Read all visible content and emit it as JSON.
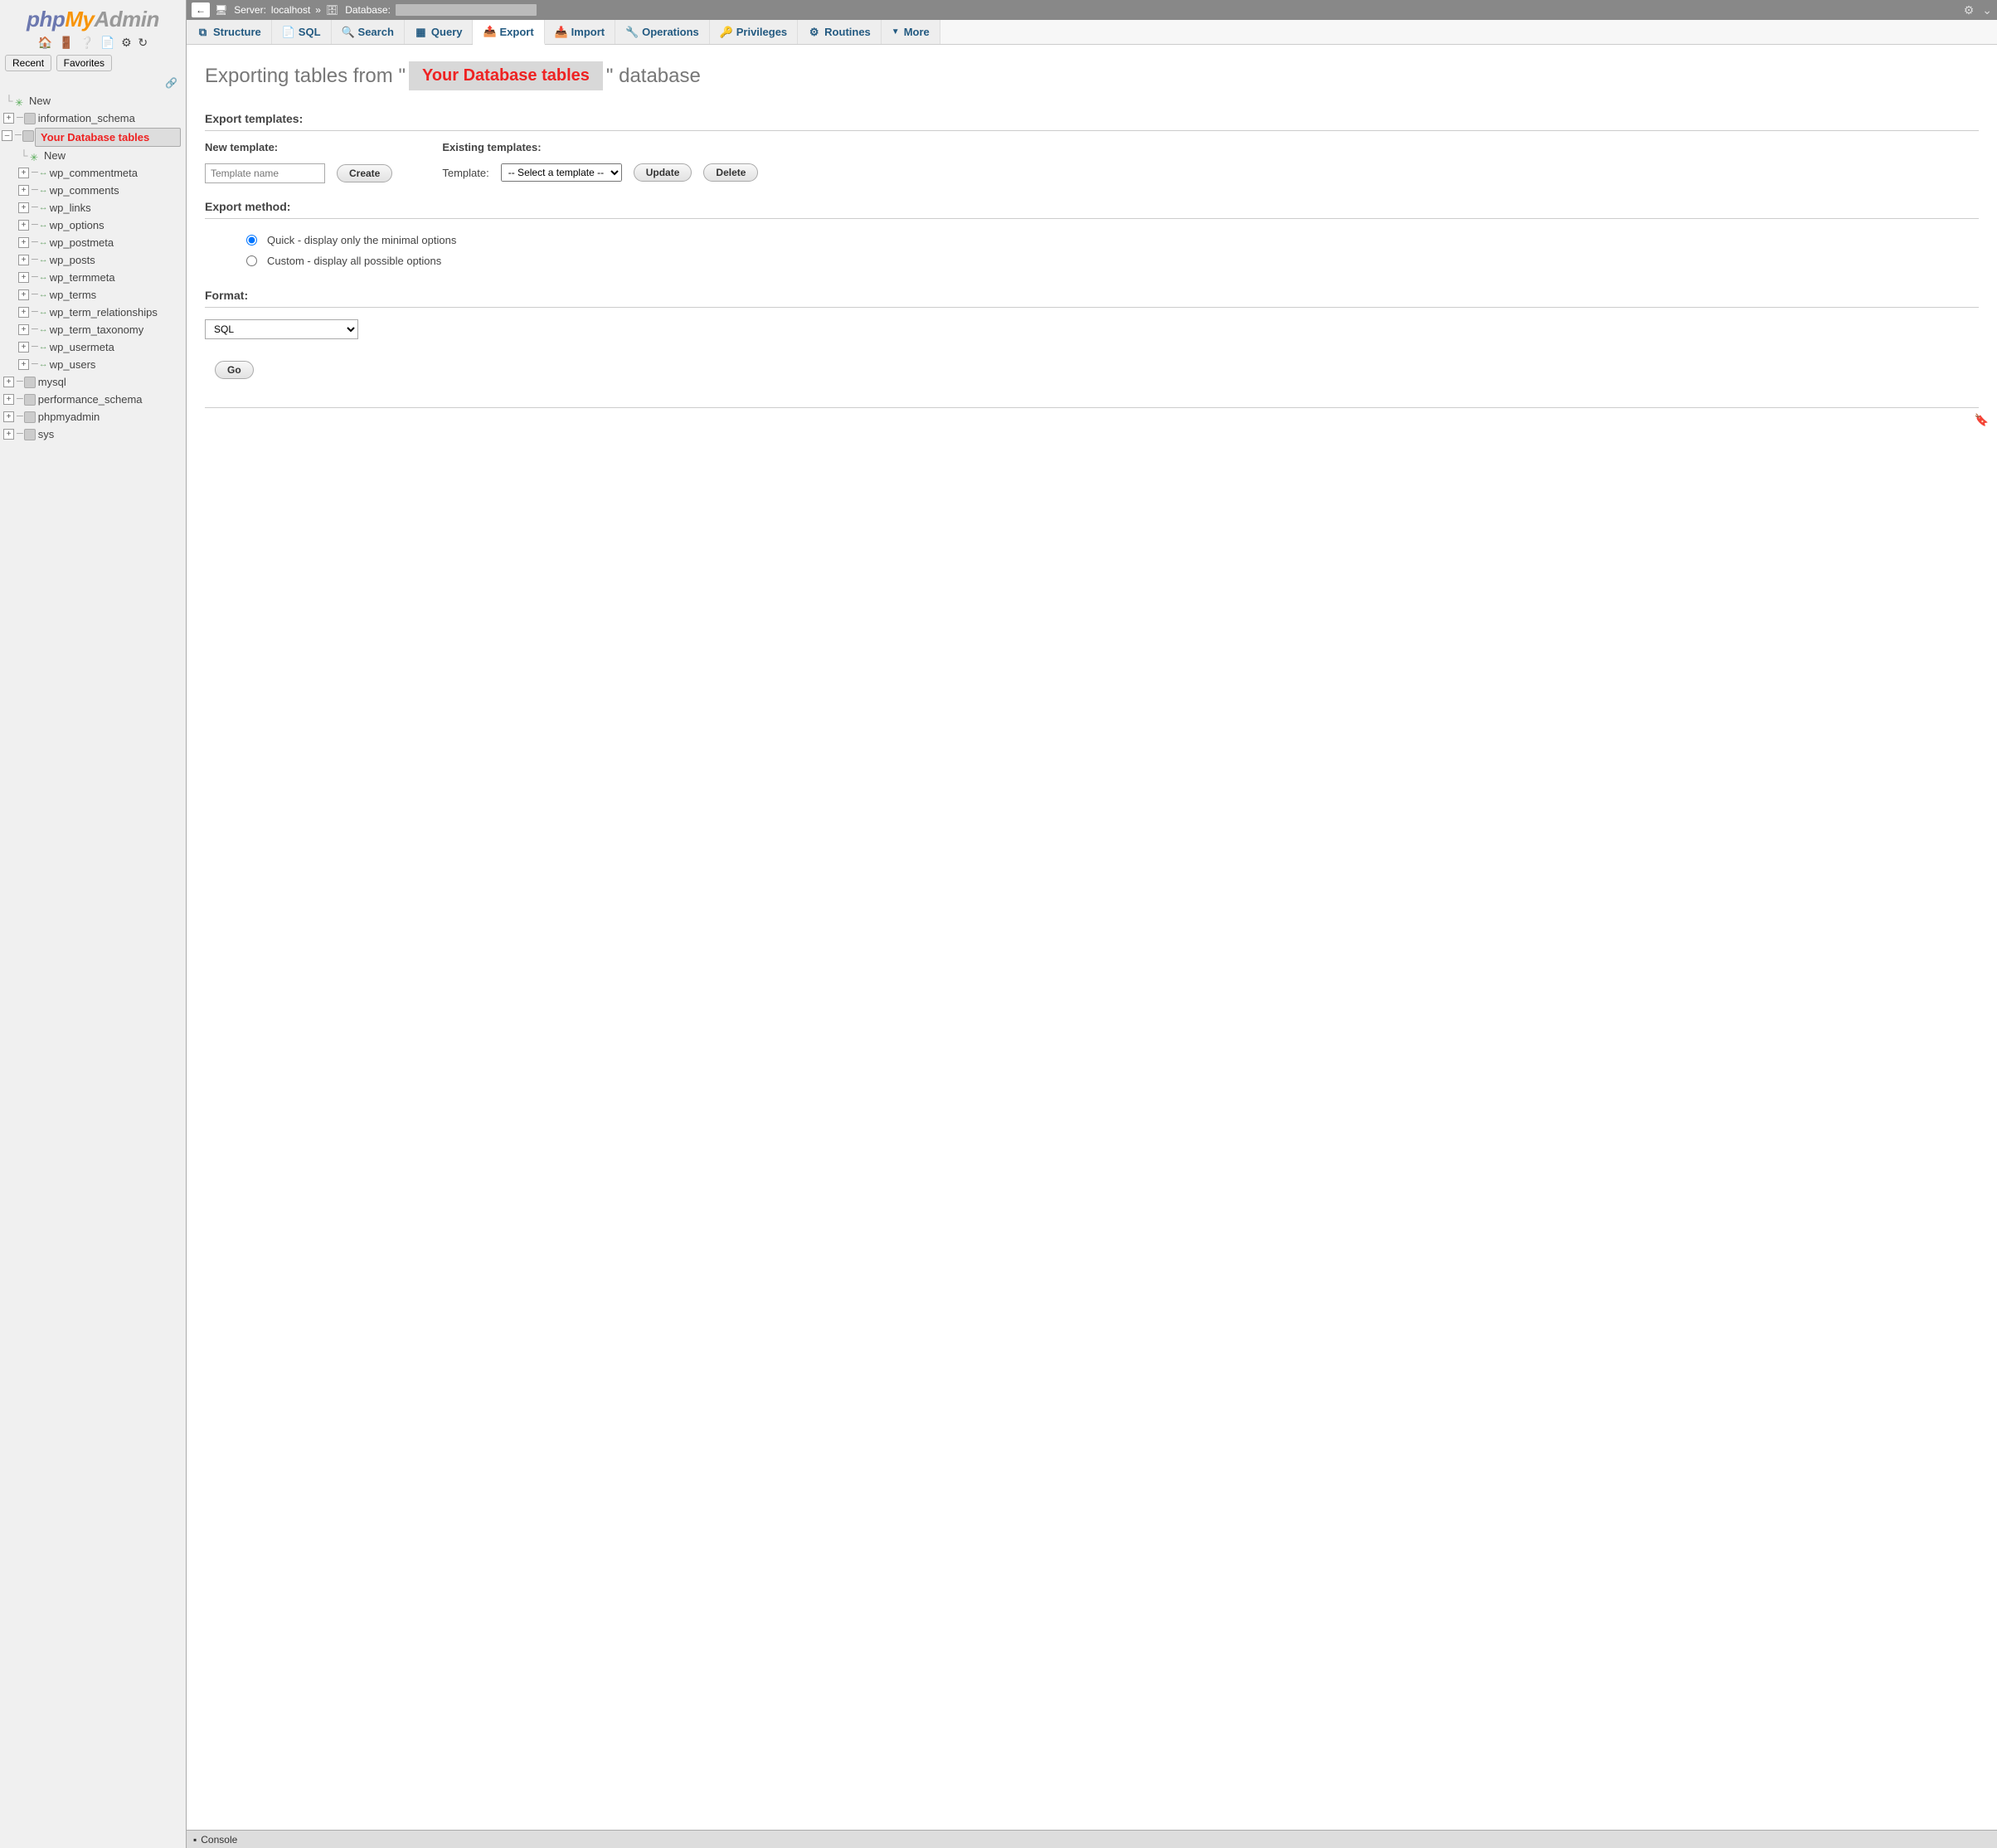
{
  "logo": {
    "part1": "php",
    "part2": "My",
    "part3": "Admin"
  },
  "sidebar": {
    "recent": "Recent",
    "favorites": "Favorites",
    "node_new": "New",
    "databases": [
      {
        "name": "information_schema",
        "expanded": false
      },
      {
        "name": "Your Database tables",
        "expanded": true,
        "active": true,
        "children_new": "New",
        "tables": [
          "wp_commentmeta",
          "wp_comments",
          "wp_links",
          "wp_options",
          "wp_postmeta",
          "wp_posts",
          "wp_termmeta",
          "wp_terms",
          "wp_term_relationships",
          "wp_term_taxonomy",
          "wp_usermeta",
          "wp_users"
        ]
      },
      {
        "name": "mysql",
        "expanded": false
      },
      {
        "name": "performance_schema",
        "expanded": false
      },
      {
        "name": "phpmyadmin",
        "expanded": false
      },
      {
        "name": "sys",
        "expanded": false
      }
    ]
  },
  "breadcrumb": {
    "server_label": "Server:",
    "server_value": "localhost",
    "sep": "»",
    "database_label": "Database:"
  },
  "tabs": [
    {
      "id": "structure",
      "label": "Structure",
      "icon": "⧉"
    },
    {
      "id": "sql",
      "label": "SQL",
      "icon": "📄"
    },
    {
      "id": "search",
      "label": "Search",
      "icon": "🔍"
    },
    {
      "id": "query",
      "label": "Query",
      "icon": "▦"
    },
    {
      "id": "export",
      "label": "Export",
      "icon": "📤",
      "active": true
    },
    {
      "id": "import",
      "label": "Import",
      "icon": "📥"
    },
    {
      "id": "operations",
      "label": "Operations",
      "icon": "🔧"
    },
    {
      "id": "privileges",
      "label": "Privileges",
      "icon": "🔑"
    },
    {
      "id": "routines",
      "label": "Routines",
      "icon": "⚙"
    },
    {
      "id": "more",
      "label": "More",
      "icon": "▾"
    }
  ],
  "page": {
    "title_prefix": "Exporting tables from \"",
    "title_highlight": "Your Database tables",
    "title_suffix": "\" database"
  },
  "sections": {
    "export_templates": "Export templates:",
    "new_template": "New template:",
    "existing_templates": "Existing templates:",
    "template_label": "Template:",
    "template_placeholder": "Template name",
    "template_select_default": "-- Select a template --",
    "create_btn": "Create",
    "update_btn": "Update",
    "delete_btn": "Delete",
    "export_method": "Export method:",
    "method_quick": "Quick - display only the minimal options",
    "method_custom": "Custom - display all possible options",
    "format": "Format:",
    "format_value": "SQL",
    "go_btn": "Go"
  },
  "console": {
    "label": "Console"
  }
}
